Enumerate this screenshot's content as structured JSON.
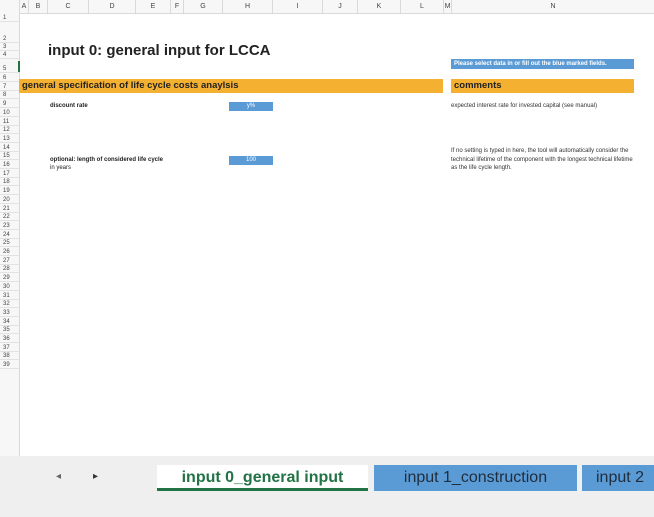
{
  "columns": [
    "A",
    "B",
    "C",
    "D",
    "E",
    "F",
    "G",
    "H",
    "I",
    "J",
    "K",
    "L",
    "M",
    "N"
  ],
  "rows": [
    "1",
    "2",
    "3",
    "4",
    "5",
    "6",
    "7",
    "8",
    "9",
    "10",
    "11",
    "12",
    "13",
    "14",
    "15",
    "16",
    "17",
    "18",
    "19",
    "20",
    "21",
    "22",
    "23",
    "24",
    "25",
    "26",
    "27",
    "28",
    "29",
    "30",
    "31",
    "32",
    "33",
    "34",
    "35",
    "36",
    "37",
    "38",
    "39"
  ],
  "sheet": {
    "title": "input 0: general input for LCCA",
    "hint": "Please select data in or fill out the blue marked fields.",
    "spec_header": "general specification of life cycle costs anaylsis",
    "comments_header": "comments",
    "discount_label": "discount rate",
    "discount_value": "y%",
    "discount_comment": "expected interest rate for invested capital (see manual)",
    "length_label": "optional: length of considered life cycle",
    "length_unit": "in years",
    "length_value": "100",
    "length_comment": "If no setting is typed in here, the tool will automatically consider the technical lifetime of the component with the longest technical lifetime as the life cycle length."
  },
  "tabs": {
    "prev": "◂",
    "next": "▸",
    "active": "input 0_general input",
    "t1": "input 1_construction",
    "t2": "input 2"
  },
  "colors": {
    "accent": "#217346",
    "blue": "#5b9bd5",
    "orange": "#f4b030"
  }
}
